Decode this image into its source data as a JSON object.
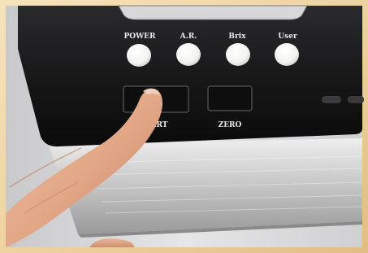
{
  "device": {
    "indicator_labels": [
      "POWER",
      "A.R.",
      "Brix",
      "User"
    ],
    "key_labels": [
      "ART",
      "ZERO"
    ]
  },
  "colors": {
    "frame": "#f2d9a6",
    "panel": "#1d1d1f",
    "metal": "#c8c8c8",
    "indicator": "#f7f7f5",
    "skin": "#e2a888"
  }
}
